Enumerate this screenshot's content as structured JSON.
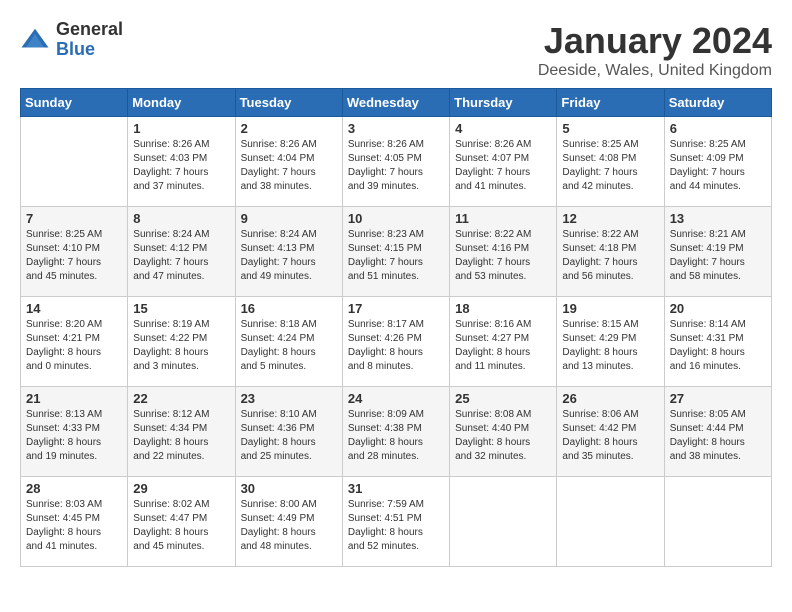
{
  "header": {
    "logo_general": "General",
    "logo_blue": "Blue",
    "month_title": "January 2024",
    "location": "Deeside, Wales, United Kingdom"
  },
  "days_of_week": [
    "Sunday",
    "Monday",
    "Tuesday",
    "Wednesday",
    "Thursday",
    "Friday",
    "Saturday"
  ],
  "weeks": [
    [
      {
        "day": "",
        "info": ""
      },
      {
        "day": "1",
        "info": "Sunrise: 8:26 AM\nSunset: 4:03 PM\nDaylight: 7 hours\nand 37 minutes."
      },
      {
        "day": "2",
        "info": "Sunrise: 8:26 AM\nSunset: 4:04 PM\nDaylight: 7 hours\nand 38 minutes."
      },
      {
        "day": "3",
        "info": "Sunrise: 8:26 AM\nSunset: 4:05 PM\nDaylight: 7 hours\nand 39 minutes."
      },
      {
        "day": "4",
        "info": "Sunrise: 8:26 AM\nSunset: 4:07 PM\nDaylight: 7 hours\nand 41 minutes."
      },
      {
        "day": "5",
        "info": "Sunrise: 8:25 AM\nSunset: 4:08 PM\nDaylight: 7 hours\nand 42 minutes."
      },
      {
        "day": "6",
        "info": "Sunrise: 8:25 AM\nSunset: 4:09 PM\nDaylight: 7 hours\nand 44 minutes."
      }
    ],
    [
      {
        "day": "7",
        "info": "Sunrise: 8:25 AM\nSunset: 4:10 PM\nDaylight: 7 hours\nand 45 minutes."
      },
      {
        "day": "8",
        "info": "Sunrise: 8:24 AM\nSunset: 4:12 PM\nDaylight: 7 hours\nand 47 minutes."
      },
      {
        "day": "9",
        "info": "Sunrise: 8:24 AM\nSunset: 4:13 PM\nDaylight: 7 hours\nand 49 minutes."
      },
      {
        "day": "10",
        "info": "Sunrise: 8:23 AM\nSunset: 4:15 PM\nDaylight: 7 hours\nand 51 minutes."
      },
      {
        "day": "11",
        "info": "Sunrise: 8:22 AM\nSunset: 4:16 PM\nDaylight: 7 hours\nand 53 minutes."
      },
      {
        "day": "12",
        "info": "Sunrise: 8:22 AM\nSunset: 4:18 PM\nDaylight: 7 hours\nand 56 minutes."
      },
      {
        "day": "13",
        "info": "Sunrise: 8:21 AM\nSunset: 4:19 PM\nDaylight: 7 hours\nand 58 minutes."
      }
    ],
    [
      {
        "day": "14",
        "info": "Sunrise: 8:20 AM\nSunset: 4:21 PM\nDaylight: 8 hours\nand 0 minutes."
      },
      {
        "day": "15",
        "info": "Sunrise: 8:19 AM\nSunset: 4:22 PM\nDaylight: 8 hours\nand 3 minutes."
      },
      {
        "day": "16",
        "info": "Sunrise: 8:18 AM\nSunset: 4:24 PM\nDaylight: 8 hours\nand 5 minutes."
      },
      {
        "day": "17",
        "info": "Sunrise: 8:17 AM\nSunset: 4:26 PM\nDaylight: 8 hours\nand 8 minutes."
      },
      {
        "day": "18",
        "info": "Sunrise: 8:16 AM\nSunset: 4:27 PM\nDaylight: 8 hours\nand 11 minutes."
      },
      {
        "day": "19",
        "info": "Sunrise: 8:15 AM\nSunset: 4:29 PM\nDaylight: 8 hours\nand 13 minutes."
      },
      {
        "day": "20",
        "info": "Sunrise: 8:14 AM\nSunset: 4:31 PM\nDaylight: 8 hours\nand 16 minutes."
      }
    ],
    [
      {
        "day": "21",
        "info": "Sunrise: 8:13 AM\nSunset: 4:33 PM\nDaylight: 8 hours\nand 19 minutes."
      },
      {
        "day": "22",
        "info": "Sunrise: 8:12 AM\nSunset: 4:34 PM\nDaylight: 8 hours\nand 22 minutes."
      },
      {
        "day": "23",
        "info": "Sunrise: 8:10 AM\nSunset: 4:36 PM\nDaylight: 8 hours\nand 25 minutes."
      },
      {
        "day": "24",
        "info": "Sunrise: 8:09 AM\nSunset: 4:38 PM\nDaylight: 8 hours\nand 28 minutes."
      },
      {
        "day": "25",
        "info": "Sunrise: 8:08 AM\nSunset: 4:40 PM\nDaylight: 8 hours\nand 32 minutes."
      },
      {
        "day": "26",
        "info": "Sunrise: 8:06 AM\nSunset: 4:42 PM\nDaylight: 8 hours\nand 35 minutes."
      },
      {
        "day": "27",
        "info": "Sunrise: 8:05 AM\nSunset: 4:44 PM\nDaylight: 8 hours\nand 38 minutes."
      }
    ],
    [
      {
        "day": "28",
        "info": "Sunrise: 8:03 AM\nSunset: 4:45 PM\nDaylight: 8 hours\nand 41 minutes."
      },
      {
        "day": "29",
        "info": "Sunrise: 8:02 AM\nSunset: 4:47 PM\nDaylight: 8 hours\nand 45 minutes."
      },
      {
        "day": "30",
        "info": "Sunrise: 8:00 AM\nSunset: 4:49 PM\nDaylight: 8 hours\nand 48 minutes."
      },
      {
        "day": "31",
        "info": "Sunrise: 7:59 AM\nSunset: 4:51 PM\nDaylight: 8 hours\nand 52 minutes."
      },
      {
        "day": "",
        "info": ""
      },
      {
        "day": "",
        "info": ""
      },
      {
        "day": "",
        "info": ""
      }
    ]
  ]
}
